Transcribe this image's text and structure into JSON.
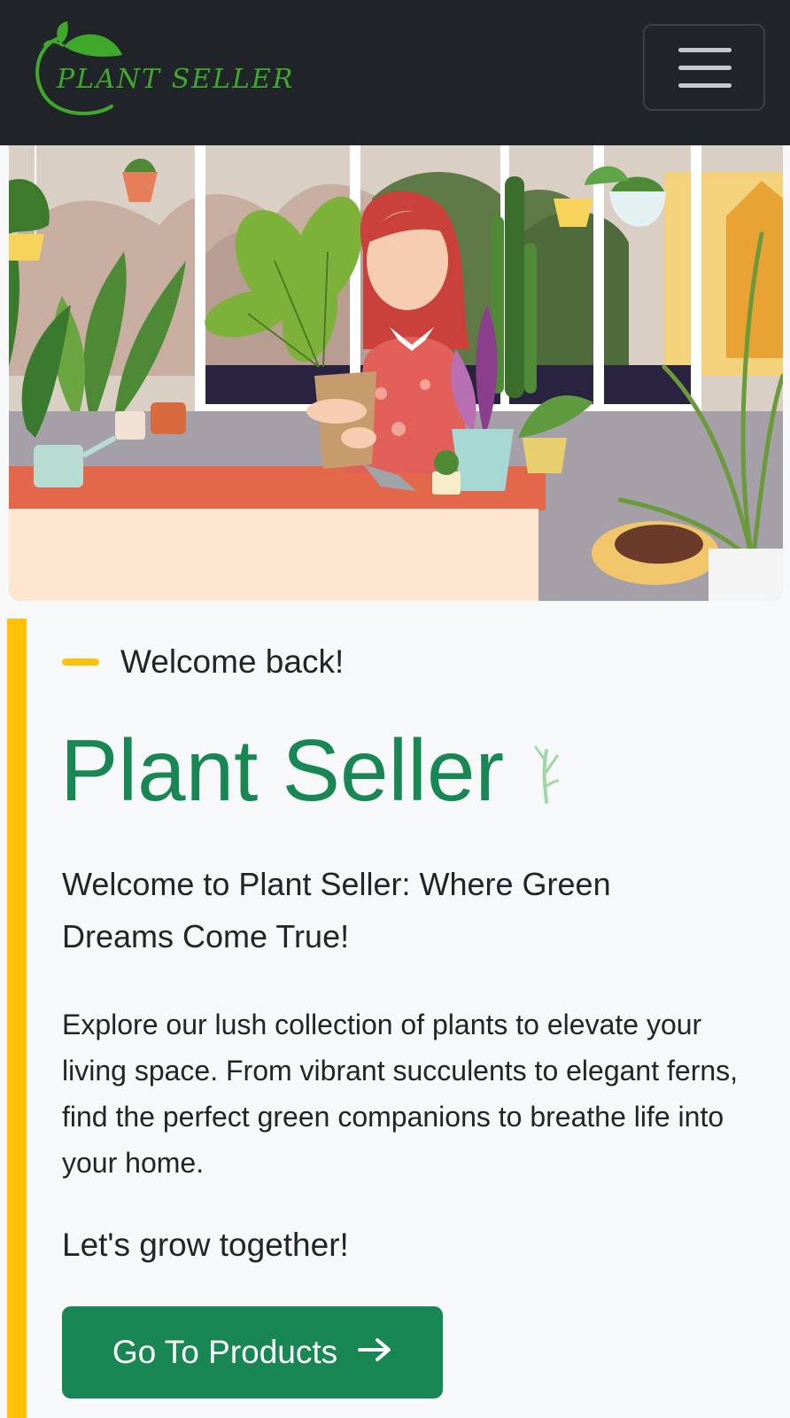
{
  "navbar": {
    "brand_text": "PLANT SELLER",
    "menu_icon": "hamburger-icon"
  },
  "hero": {
    "image": "illustration of a woman holding a potted plant in a greenhouse shop with hanging plants and a sleeping dog"
  },
  "welcome": {
    "eyebrow": "Welcome back!",
    "title": "Plant Seller",
    "title_icon": "sprout-icon",
    "lead": "Welcome to Plant Seller: Where Green Dreams Come True!",
    "body": "Explore our lush collection of plants to elevate your living space. From vibrant succulents to elegant ferns, find the perfect green companions to breathe life into your home.",
    "tagline": "Let's grow together!",
    "cta_label": "Go To Products",
    "cta_icon": "arrow-right-icon"
  },
  "colors": {
    "navbar_bg": "#212529",
    "brand_green": "#3fa92b",
    "primary_green": "#198754",
    "accent_yellow": "#ffc107",
    "page_bg": "#f7f8fa"
  }
}
